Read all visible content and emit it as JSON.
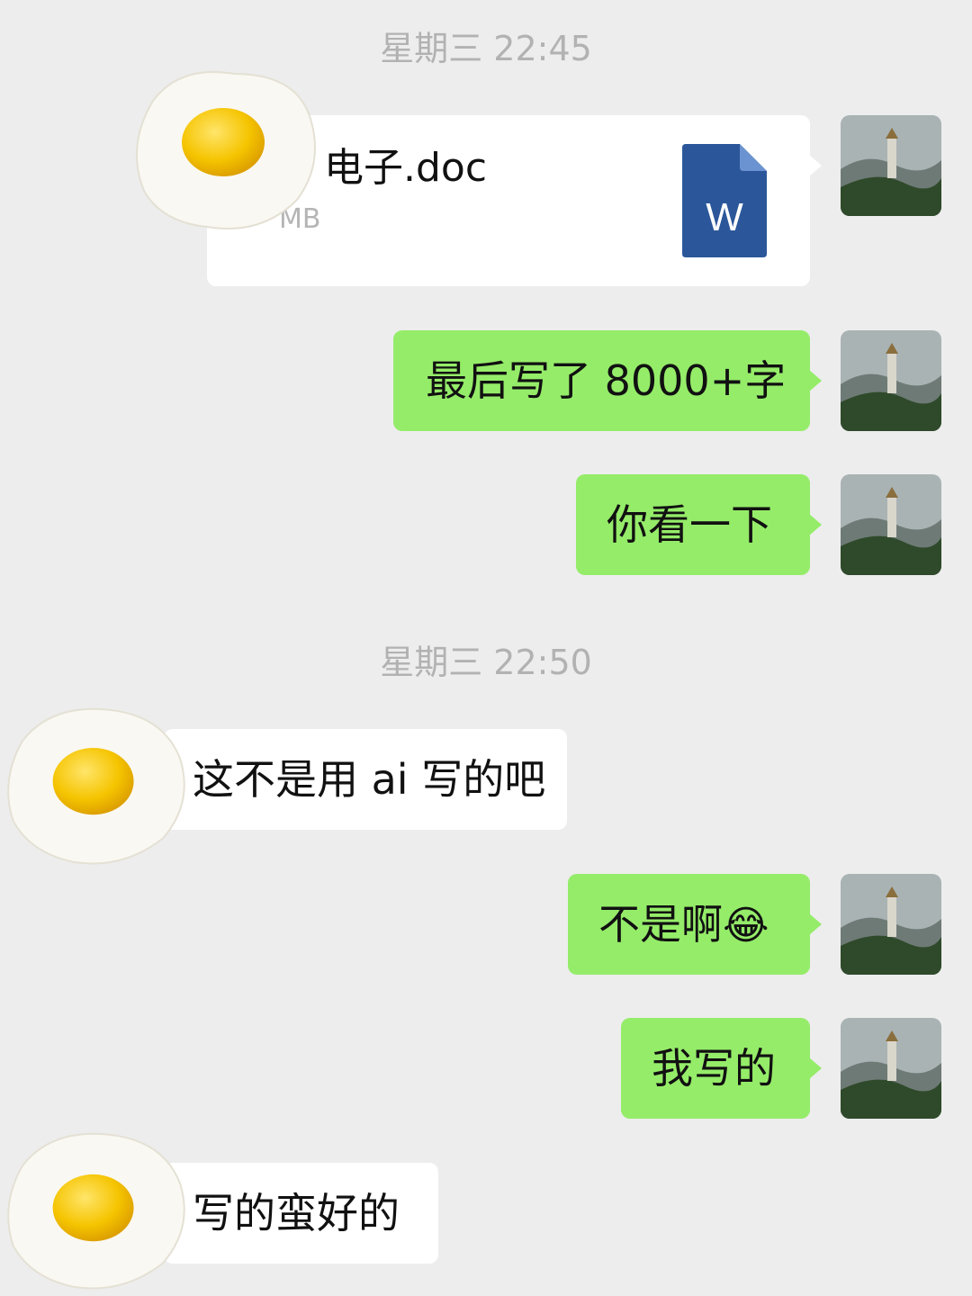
{
  "timestamps": [
    "星期三 22:45",
    "星期三 22:50"
  ],
  "file_message": {
    "name": "电子.doc",
    "size": "MB",
    "icon_letter": "W",
    "icon": "word-document-icon"
  },
  "messages": [
    {
      "side": "sent",
      "text": "最后写了 8000+字"
    },
    {
      "side": "sent",
      "text": "你看一下"
    },
    {
      "side": "recv",
      "text": "这不是用 ai 写的吧"
    },
    {
      "side": "sent",
      "text": "不是啊",
      "emoji": "😂"
    },
    {
      "side": "sent",
      "text": "我写的"
    },
    {
      "side": "recv",
      "text": "写的蛮好的"
    }
  ],
  "colors": {
    "sent_bubble": "#95ec69",
    "recv_bubble": "#ffffff",
    "background": "#ededed",
    "word_blue": "#2b579a"
  },
  "avatar_icon": "pagoda-landscape-avatar",
  "contact_avatar_icon": "fried-egg-avatar"
}
